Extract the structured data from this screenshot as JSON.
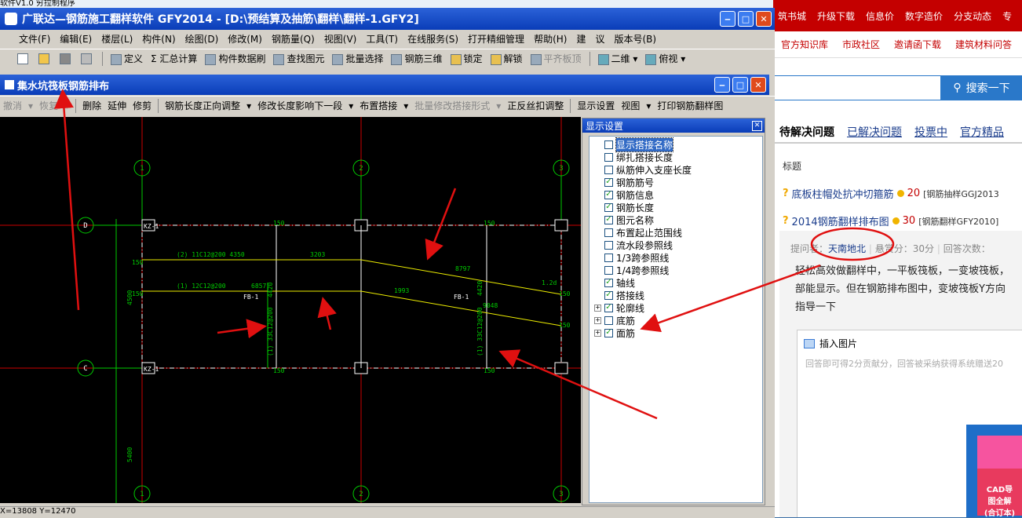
{
  "desktop": {
    "top_text": "软件V1.0    穷拉制程序"
  },
  "web": {
    "nav1": [
      "筑书城",
      "升级下载",
      "信息价",
      "数字造价",
      "分支动态",
      "专"
    ],
    "nav2": [
      "官方知识库",
      "市政社区",
      "邀请函下载",
      "建筑材料问答"
    ],
    "search_btn": "搜索一下",
    "tabs": [
      "待解决问题",
      "已解决问题",
      "投票中",
      "官方精品"
    ],
    "list_label": "标题",
    "questions": [
      {
        "title": "底板柱帽处抗冲切箍筋",
        "points": "20",
        "tag": "[钢筋抽样GGJ2013"
      },
      {
        "title": "2014钢筋翻样排布图",
        "points": "30",
        "tag": "[钢筋翻样GFY2010]"
      }
    ],
    "meta": {
      "asker_label": "提问者：",
      "asker": "天南地北",
      "reward": "悬赏分：30分",
      "answers": "回答次数："
    },
    "body": "轻松高效做翻样中，一平板筏板，一变坡筏板，\n部能显示。但在钢筋排布图中，变坡筏板Y方向\n指导一下",
    "insert_image": "插入图片",
    "answer_hint": "回答即可得2分贡献分，回答被采纳获得系统赠送20",
    "ad": {
      "text1": "CAD导",
      "text2": "图全解",
      "text3": "(合订本)"
    }
  },
  "app": {
    "title": "广联达—钢筋施工翻样软件 GFY2014 - [D:\\预结算及抽筋\\翻样\\翻样-1.GFY2]",
    "menu": [
      "文件(F)",
      "编辑(E)",
      "楼层(L)",
      "构件(N)",
      "绘图(D)",
      "修改(M)",
      "钢筋量(Q)",
      "视图(V)",
      "工具(T)",
      "在线服务(S)",
      "打开精细管理",
      "帮助(H)",
      "建",
      "议",
      "版本号(B)"
    ],
    "toolbar": [
      "定义",
      "汇总计算",
      "构件数据刷",
      "查找图元",
      "批量选择",
      "钢筋三维",
      "锁定",
      "解锁",
      "平齐板顶",
      "二维",
      "俯视"
    ]
  },
  "inner": {
    "title": "集水坑筏板钢筋排布",
    "toolbar": [
      "撤消",
      "恢复",
      "删除",
      "延伸",
      "修剪",
      "钢筋长度正向调整",
      "修改长度影响下一段",
      "布置搭接",
      "批量修改搭接形式",
      "正反丝扣调整",
      "显示设置",
      "视图",
      "打印钢筋翻样图"
    ]
  },
  "panel": {
    "title": "显示设置",
    "items": [
      {
        "label": "显示搭接名称",
        "checked": false,
        "expand": false,
        "selected": true
      },
      {
        "label": "绑扎搭接长度",
        "checked": false,
        "expand": false
      },
      {
        "label": "纵筋伸入支座长度",
        "checked": false,
        "expand": false
      },
      {
        "label": "钢筋筋号",
        "checked": true,
        "expand": false
      },
      {
        "label": "钢筋信息",
        "checked": true,
        "expand": false
      },
      {
        "label": "钢筋长度",
        "checked": true,
        "expand": false
      },
      {
        "label": "图元名称",
        "checked": true,
        "expand": false
      },
      {
        "label": "布置起止范围线",
        "checked": false,
        "expand": false
      },
      {
        "label": "流水段参照线",
        "checked": false,
        "expand": false
      },
      {
        "label": "1/3跨参照线",
        "checked": false,
        "expand": false
      },
      {
        "label": "1/4跨参照线",
        "checked": false,
        "expand": false
      },
      {
        "label": "轴线",
        "checked": true,
        "expand": false
      },
      {
        "label": "搭接线",
        "checked": true,
        "expand": false
      },
      {
        "label": "轮廓线",
        "checked": true,
        "expand": true
      },
      {
        "label": "底筋",
        "checked": false,
        "expand": true
      },
      {
        "label": "面筋",
        "checked": true,
        "expand": true
      }
    ]
  },
  "drawing": {
    "axes_top": [
      "1",
      "2",
      "3"
    ],
    "axes_left": [
      "D",
      "C"
    ],
    "dims": [
      "4500",
      "5400"
    ],
    "rebar1": "(2) 11C12@200  4350",
    "rebar1_len": "3203",
    "rebar2": "(1) 12C12@200",
    "rebar2_len": "6857",
    "sloped1": "8797",
    "sloped2": "1993",
    "sloped3": "9048",
    "fb": "FB-1",
    "kz": "KZ-1",
    "v1": "(1) 33C12@200",
    "v2": "(1) 33C12@200",
    "v3": "4420",
    "v4": "4420",
    "e150": "150",
    "e12": "1.2d",
    "coords": "X=13808 Y=12470"
  }
}
